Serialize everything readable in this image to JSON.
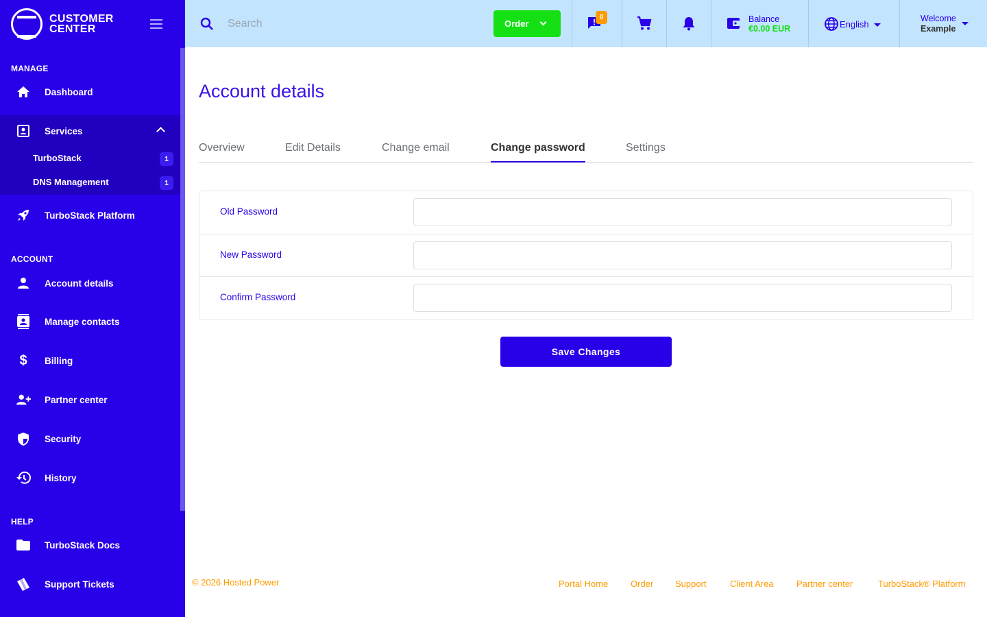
{
  "brand": {
    "line1": "CUSTOMER",
    "line2": "CENTER"
  },
  "sidebar": {
    "sections": {
      "manage": "MANAGE",
      "account": "ACCOUNT",
      "help": "HELP"
    },
    "items": {
      "dashboard": "Dashboard",
      "services": "Services",
      "turbostack": "TurboStack",
      "turbostack_count": "1",
      "dns": "DNS Management",
      "dns_count": "1",
      "platform": "TurboStack Platform",
      "account_details": "Account details",
      "manage_contacts": "Manage contacts",
      "billing": "Billing",
      "partner_center": "Partner center",
      "security": "Security",
      "history": "History",
      "docs": "TurboStack Docs",
      "tickets": "Support Tickets"
    }
  },
  "topbar": {
    "search_placeholder": "Search",
    "order_label": "Order",
    "chat_count": "0",
    "balance_label": "Balance",
    "balance_value": "€0.00 EUR",
    "language": "English",
    "welcome_label": "Welcome",
    "welcome_name": "Example"
  },
  "page": {
    "title": "Account details",
    "tabs": [
      "Overview",
      "Edit Details",
      "Change email",
      "Change password",
      "Settings"
    ],
    "active_tab": "Change password"
  },
  "form": {
    "old_password_label": "Old Password",
    "new_password_label": "New Password",
    "confirm_password_label": "Confirm Password",
    "save_label": "Save Changes"
  },
  "footer": {
    "copyright": "© 2026 Hosted Power",
    "links": [
      "Portal Home",
      "Order",
      "Support",
      "Client Area",
      "Partner center",
      "TurboStack® Platform"
    ]
  },
  "colors": {
    "primary": "#2a00e8",
    "topbar": "#c2e4fe",
    "order": "#14e014",
    "accent": "#ff9b00"
  }
}
